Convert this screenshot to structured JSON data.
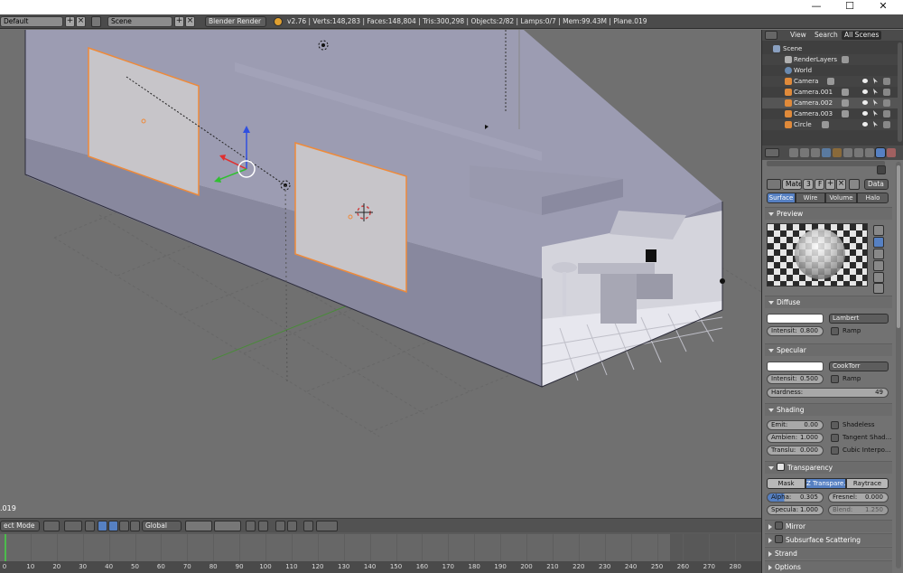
{
  "window": {
    "minimize": "—",
    "maximize": "☐",
    "close": "✕"
  },
  "info_header": {
    "layout": "Default",
    "scene": "Scene",
    "engine": "Blender Render",
    "stats": "v2.76 | Verts:148,283 | Faces:148,804 | Tris:300,298 | Objects:2/82 | Lamps:0/7 | Mem:99.43M | Plane.019"
  },
  "viewport": {
    "object_label": ".019"
  },
  "view3d_header": {
    "mode": "ect Mode",
    "orientation": "Global"
  },
  "timeline": {
    "ticks": [
      "0",
      "10",
      "20",
      "30",
      "40",
      "50",
      "60",
      "70",
      "80",
      "90",
      "100",
      "110",
      "120",
      "130",
      "140",
      "150",
      "160",
      "170",
      "180",
      "190",
      "200",
      "210",
      "220",
      "230",
      "240",
      "250",
      "260",
      "270",
      "280"
    ]
  },
  "outliner": {
    "tabs": [
      "View",
      "Search",
      "All Scenes"
    ],
    "rows": [
      "Scene",
      "RenderLayers",
      "World",
      "Camera",
      "Camera.001",
      "Camera.002",
      "Camera.003",
      "Circle"
    ]
  },
  "properties": {
    "material_name": "Mate",
    "users": "3",
    "fake": "F",
    "link": "Data",
    "tabs": [
      "Surface",
      "Wire",
      "Volume",
      "Halo"
    ],
    "preview": {
      "title": "Preview"
    },
    "diffuse": {
      "title": "Diffuse",
      "shader": "Lambert",
      "intensity_label": "Intensit:",
      "intensity": "0.800",
      "ramp": "Ramp"
    },
    "specular": {
      "title": "Specular",
      "shader": "CookTorr",
      "intensity_label": "Intensit:",
      "intensity": "0.500",
      "ramp": "Ramp",
      "hardness_label": "Hardness:",
      "hardness": "49"
    },
    "shading": {
      "title": "Shading",
      "emit_label": "Emit:",
      "emit": "0.00",
      "ambient_label": "Ambien:",
      "ambient": "1.000",
      "translucency_label": "Translu:",
      "translucency": "0.000",
      "shadeless": "Shadeless",
      "tangent": "Tangent Shad...",
      "cubic": "Cubic Interpo..."
    },
    "transparency": {
      "title": "Transparency",
      "modes": [
        "Mask",
        "Z Transpare...",
        "Raytrace"
      ],
      "alpha_label": "Alpha:",
      "alpha": "0.305",
      "fresnel_label": "Fresnel:",
      "fresnel": "0.000",
      "specular_label": "Specula:",
      "specular": "1.000",
      "blend_label": "Blend:",
      "blend": "1.250"
    },
    "collapsed": [
      "Mirror",
      "Subsurface Scattering",
      "Strand",
      "Options"
    ]
  }
}
